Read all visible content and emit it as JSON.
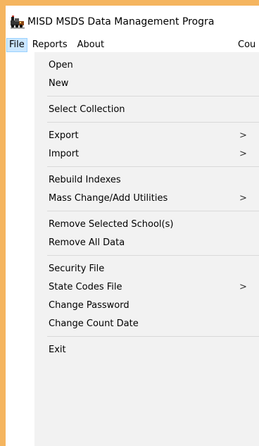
{
  "window": {
    "title": "MISD MSDS Data Management Progra",
    "icon": "app-train-icon"
  },
  "menubar": {
    "items": [
      {
        "label": "File",
        "active": true
      },
      {
        "label": "Reports"
      },
      {
        "label": "About"
      }
    ],
    "partial_item": "Cou"
  },
  "file_menu": {
    "open": "Open",
    "new": "New",
    "select_collection": "Select Collection",
    "export": "Export",
    "import": "Import",
    "rebuild_indexes": "Rebuild Indexes",
    "mass_change": "Mass Change/Add Utilities",
    "remove_selected": "Remove Selected School(s)",
    "remove_all": "Remove All Data",
    "security_file": "Security File",
    "state_codes_file": "State Codes File",
    "change_password": "Change Password",
    "change_count_date": "Change Count Date",
    "exit": "Exit",
    "submenu_arrow": ">"
  },
  "colors": {
    "background": "#f5b55f",
    "menu_bg": "#f2f2f2",
    "active_menubar_bg": "#cce8ff",
    "active_menubar_border": "#99d1ff"
  }
}
